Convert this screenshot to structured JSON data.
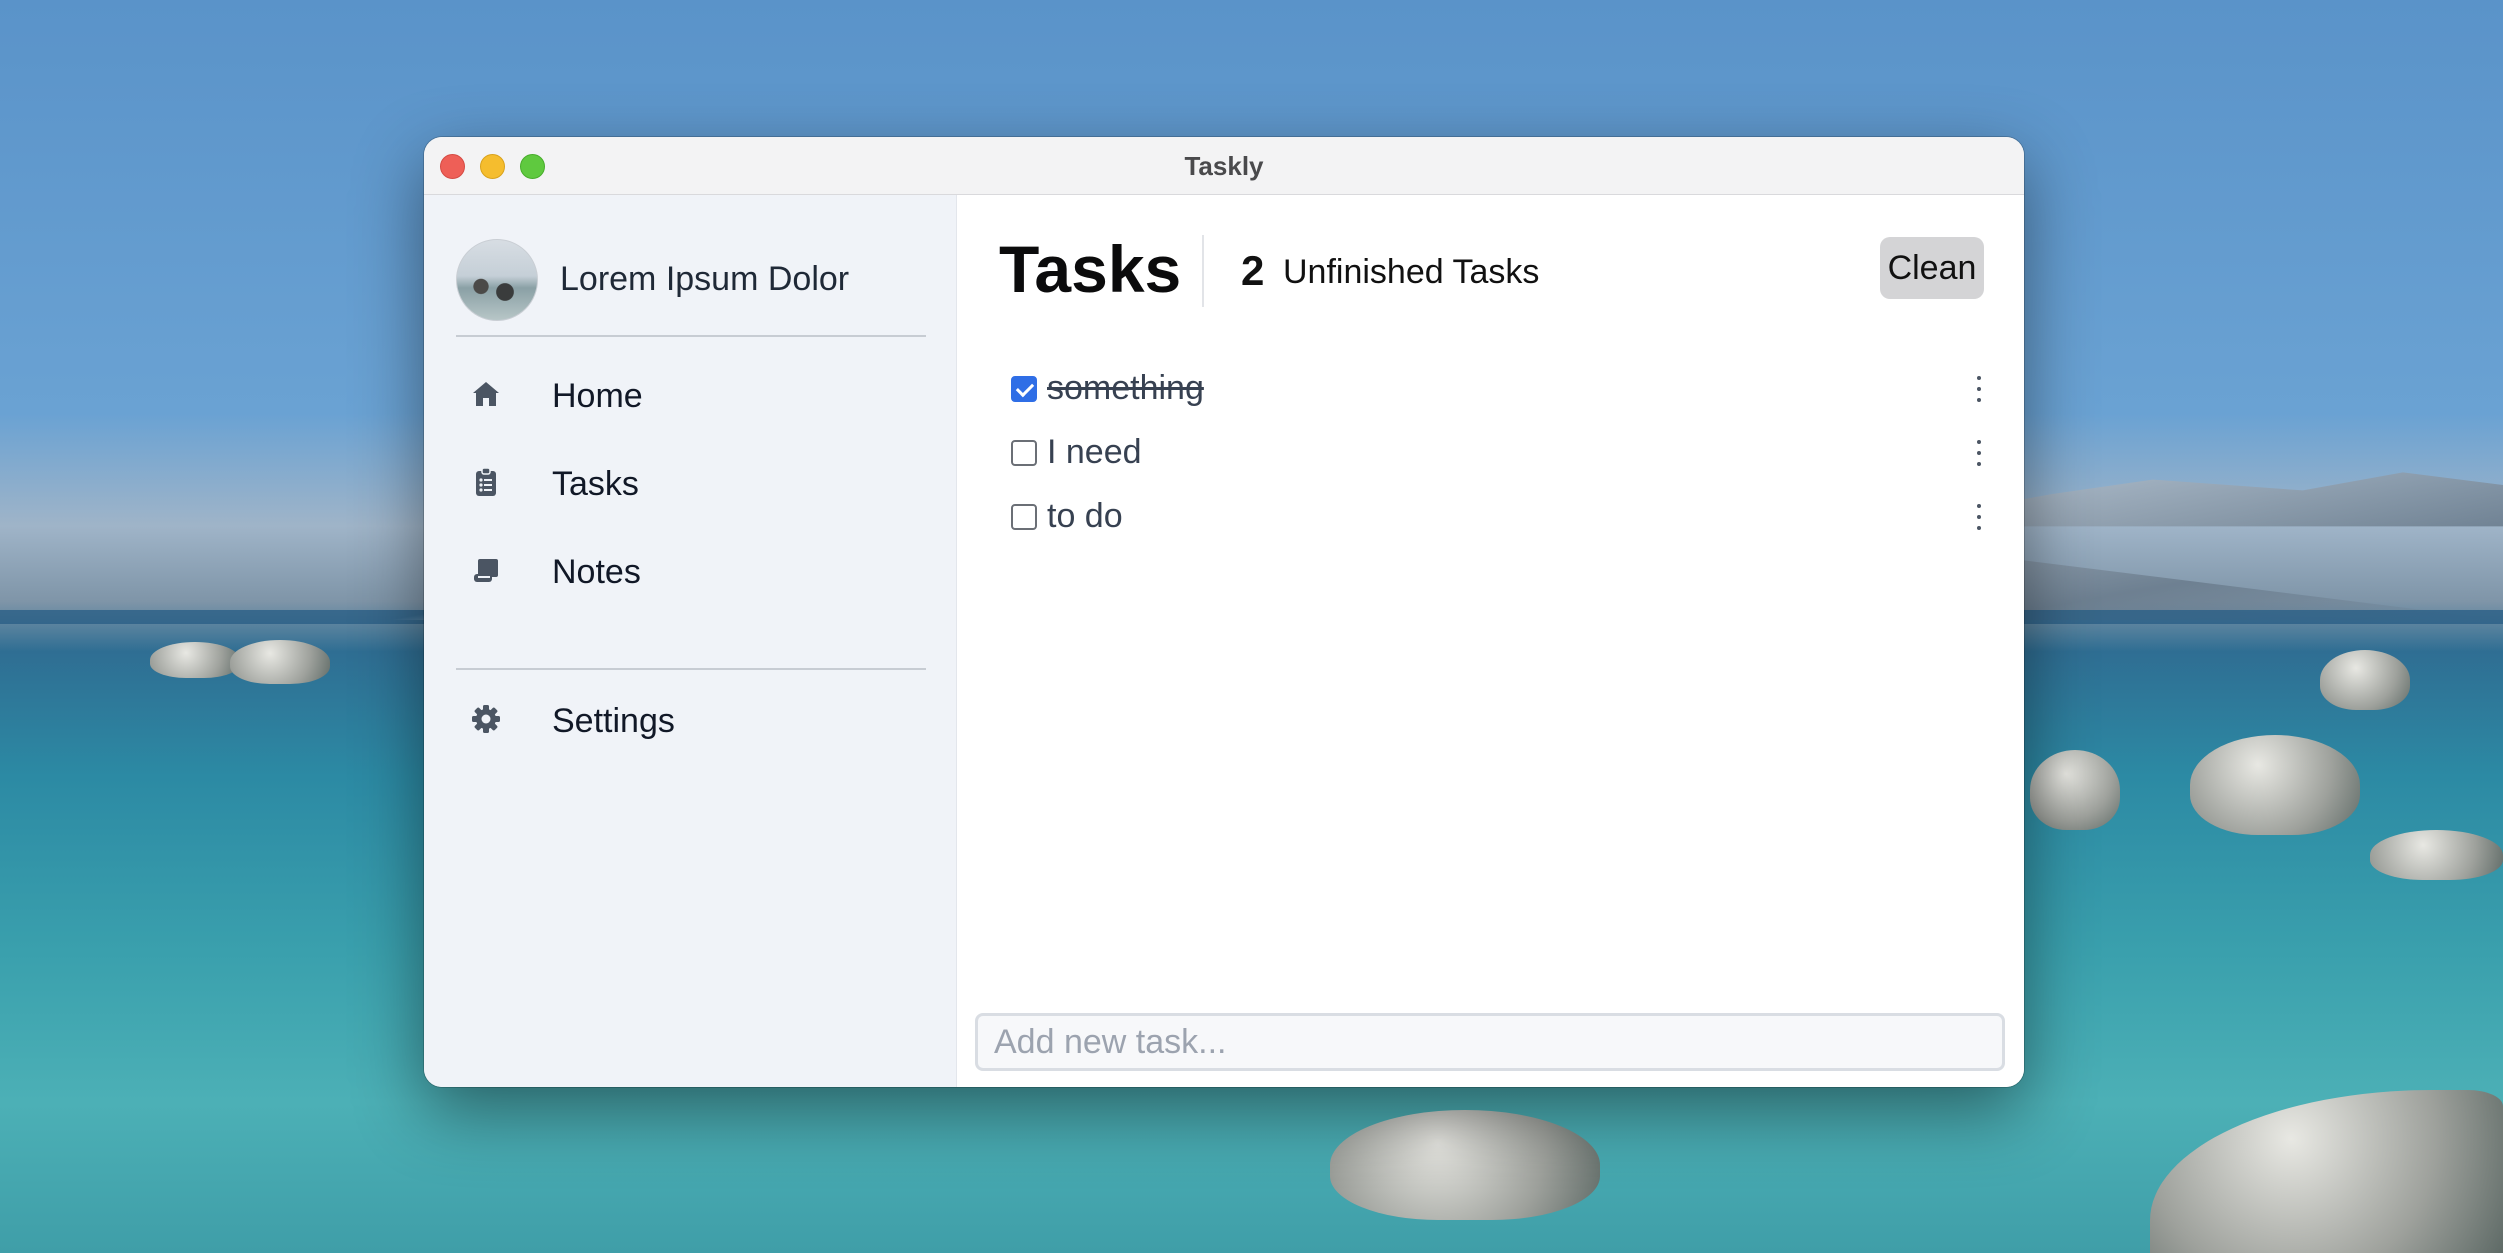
{
  "window": {
    "title": "Taskly"
  },
  "sidebar": {
    "profile": {
      "name": "Lorem Ipsum Dolor"
    },
    "items": [
      {
        "label": "Home",
        "icon": "home-icon"
      },
      {
        "label": "Tasks",
        "icon": "clipboard-list-icon"
      },
      {
        "label": "Notes",
        "icon": "note-scroll-icon"
      }
    ],
    "settings": {
      "label": "Settings",
      "icon": "gear-icon"
    }
  },
  "main": {
    "title": "Tasks",
    "unfinished_count": "2",
    "unfinished_label": "Unfinished Tasks",
    "clean_label": "Clean",
    "tasks": [
      {
        "text": "something",
        "done": true
      },
      {
        "text": "I need",
        "done": false
      },
      {
        "text": "to do",
        "done": false
      }
    ],
    "add_task": {
      "placeholder": "Add new task...",
      "value": ""
    }
  },
  "colors": {
    "accent": "#2f6ee6",
    "sidebar_bg": "#f0f3f8",
    "clean_button_bg": "#d4d4d6"
  }
}
